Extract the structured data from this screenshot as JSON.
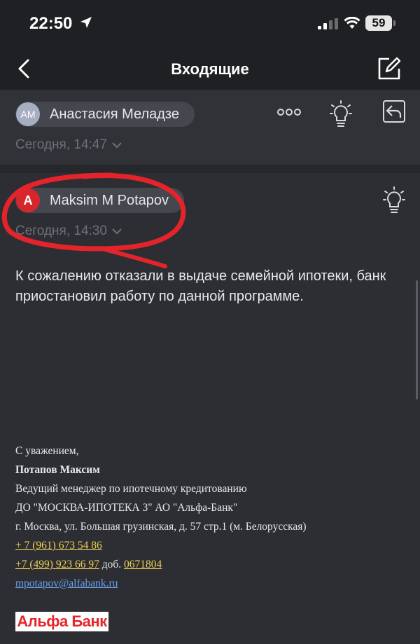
{
  "status_bar": {
    "time": "22:50",
    "battery": "59"
  },
  "nav": {
    "title": "Входящие"
  },
  "messages": [
    {
      "avatar_initials": "АМ",
      "sender": "Анастасия Меладзе",
      "date": "Сегодня, 14:47"
    },
    {
      "avatar_initials": "А",
      "sender": "Maksim M Potapov",
      "date": "Сегодня, 14:30"
    }
  ],
  "body": {
    "text": "К сожалению отказали в выдаче семейной ипотеки, банк приостановил работу по данной программе."
  },
  "signature": {
    "greeting": "С уважением,",
    "name": "Потапов Максим",
    "position": "Ведущий менеджер по ипотечному кредитованию",
    "office": "ДО \"МОСКВА-ИПОТЕКА 3\" АО \"Альфа-Банк\"",
    "address": "г. Москва, ул. Большая грузинская, д. 57 стр.1 (м. Белорусская)",
    "phone1": "+ 7 (961) 673 54 86",
    "phone2": "+7 (499) 923 66 97",
    "ext_label": "доб.",
    "ext": "0671804",
    "email": "mpotapov@alfabank.ru",
    "logo_text": "Альфа Банк"
  },
  "colors": {
    "background": "#2c2e33",
    "bar": "#1f2024",
    "link_yellow": "#f0cf56",
    "link_blue": "#6aa2ee",
    "brand_red": "#d7262b",
    "annotation_red": "#e3242b"
  },
  "icons": [
    "location-arrow-icon",
    "signal-icon",
    "wifi-icon",
    "battery-icon",
    "back-chevron-icon",
    "compose-icon",
    "more-dots-icon",
    "lightbulb-icon",
    "reply-icon",
    "chevron-down-icon"
  ]
}
